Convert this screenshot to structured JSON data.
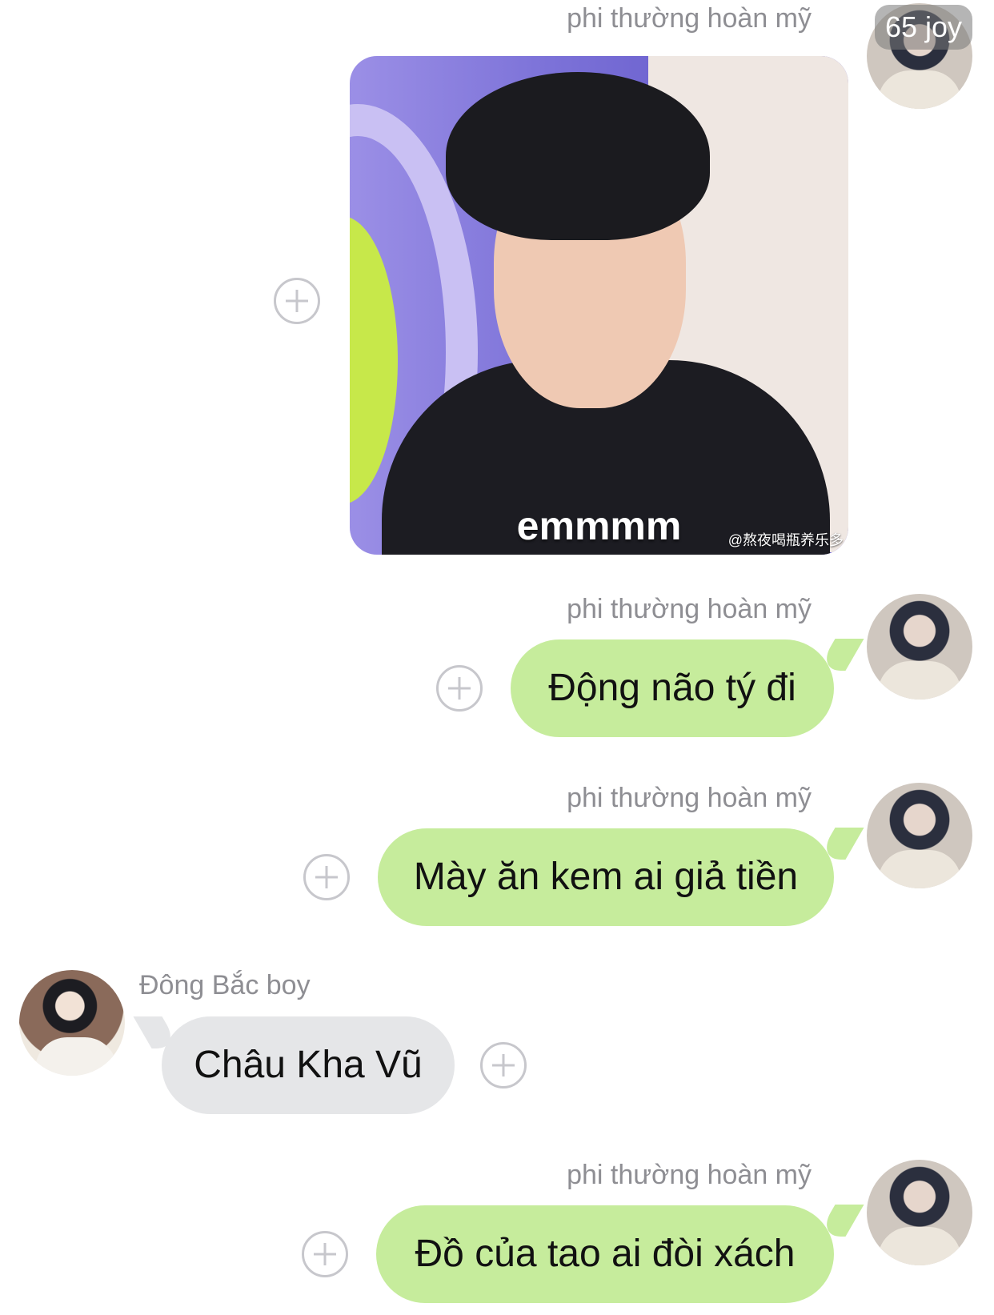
{
  "overlay_badge": "65 joy",
  "messages": [
    {
      "sender": "phi thường hoàn mỹ",
      "type": "image",
      "image_caption": "emmmm",
      "image_watermark": "@熬夜喝瓶养乐多"
    },
    {
      "sender": "phi thường hoàn mỹ",
      "type": "text",
      "text": "Động não tý đi"
    },
    {
      "sender": "phi thường hoàn mỹ",
      "type": "text",
      "text": "Mày ăn kem ai giả tiền"
    },
    {
      "sender": "Đông Bắc boy",
      "type": "text",
      "text": "Châu Kha Vũ"
    },
    {
      "sender": "phi thường hoàn mỹ",
      "type": "text",
      "text": "Đồ của tao ai đòi xách"
    }
  ],
  "colors": {
    "outgoing_bubble": "#c6ec9c",
    "incoming_bubble": "#e5e6e8",
    "sender_name": "#8e8e93"
  }
}
